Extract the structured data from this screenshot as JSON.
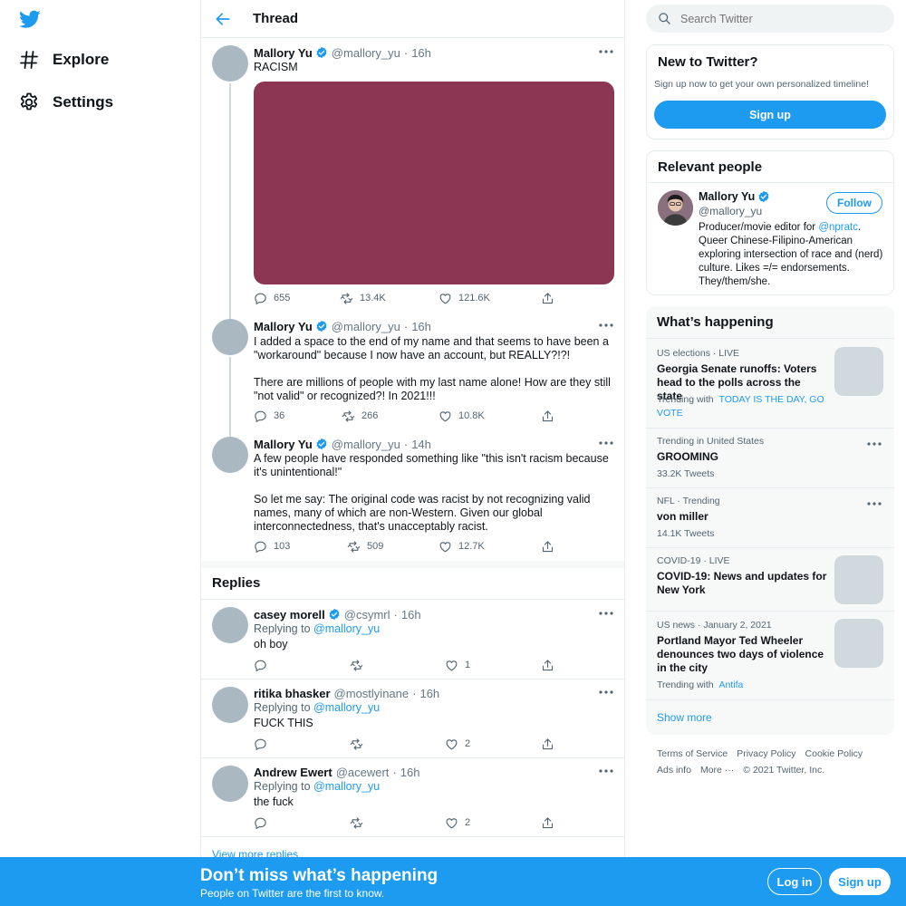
{
  "colors": {
    "accent": "#1d9bf0",
    "media": "#8b3753",
    "bottom_bar": "#1d9bf0"
  },
  "nav": {
    "logo_icon": "twitter-bird-icon",
    "items": [
      {
        "label": "Explore",
        "icon": "hashtag-icon"
      },
      {
        "label": "Settings",
        "icon": "gear-icon"
      }
    ]
  },
  "header": {
    "title": "Thread",
    "back_icon": "arrow-left-icon"
  },
  "thread": [
    {
      "name": "Mallory Yu",
      "handle": "@mallory_yu",
      "time": "16h",
      "text": "RACISM",
      "replies": "655",
      "retweets": "13.4K",
      "likes": "121.6K"
    },
    {
      "name": "Mallory Yu",
      "handle": "@mallory_yu",
      "time": "16h",
      "text": "I added a space to the end of my name and that seems to have been a \"workaround\" because I now have an account, but REALLY?!?!\n\nThere are millions of people with my last name alone! How are they still \"not valid\" or recognized?! In 2021!!!",
      "replies": "36",
      "retweets": "266",
      "likes": "10.8K"
    },
    {
      "name": "Mallory Yu",
      "handle": "@mallory_yu",
      "time": "14h",
      "text": "A few people have responded something like \"this isn't racism because it's unintentional!\"\n\nSo let me say: The original code was racist by not recognizing valid names, many of which are non-Western. Given our global interconnectedness, that's unacceptably racist.",
      "replies": "103",
      "retweets": "509",
      "likes": "12.7K"
    }
  ],
  "replies_section": {
    "title": "Replies",
    "replying_prefix": "Replying to",
    "items": [
      {
        "name": "casey morell",
        "verified": true,
        "handle": "@csymrl",
        "time": "16h",
        "replying_to": "@mallory_yu",
        "text": "oh boy",
        "likes": "1"
      },
      {
        "name": "ritika bhasker",
        "verified": false,
        "handle": "@mostlyinane",
        "time": "16h",
        "replying_to": "@mallory_yu",
        "text": "FUCK THIS",
        "likes": "2"
      },
      {
        "name": "Andrew Ewert",
        "verified": false,
        "handle": "@acewert",
        "time": "16h",
        "replying_to": "@mallory_yu",
        "text": "the fuck",
        "likes": "2"
      }
    ],
    "view_more": "View more replies"
  },
  "search": {
    "placeholder": "Search Twitter"
  },
  "new_to_twitter": {
    "title": "New to Twitter?",
    "subtitle": "Sign up now to get your own personalized timeline!",
    "button": "Sign up"
  },
  "relevant_people": {
    "title": "Relevant people",
    "name": "Mallory Yu",
    "handle": "@mallory_yu",
    "follow": "Follow",
    "bio_prefix": "Producer/movie editor for ",
    "bio_link": "@npratc",
    "bio_rest": ". Queer Chinese-Filipino-American exploring intersection of race and (nerd) culture. Likes =/= endorsements. They/them/she."
  },
  "whats_happening": {
    "title": "What’s happening",
    "trends": [
      {
        "meta": "US elections · LIVE",
        "title": "Georgia Senate runoffs: Voters head to the polls across the state",
        "sub_prefix": "Trending with",
        "sub_link": "TODAY IS THE DAY, GO VOTE",
        "has_thumb": true
      },
      {
        "meta": "Trending in United States",
        "title": "GROOMING",
        "count": "33.2K Tweets",
        "has_thumb": false
      },
      {
        "meta": "NFL · Trending",
        "title": "von miller",
        "count": "14.1K Tweets",
        "has_thumb": false
      },
      {
        "meta": "COVID-19 · LIVE",
        "title": "COVID-19: News and updates for New York",
        "has_thumb": true
      },
      {
        "meta": "US news · January 2, 2021",
        "title": "Portland Mayor Ted Wheeler denounces two days of violence in the city",
        "sub_prefix": "Trending with",
        "sub_link": "Antifa",
        "has_thumb": true
      }
    ],
    "show_more": "Show more"
  },
  "footer": {
    "links": [
      "Terms of Service",
      "Privacy Policy",
      "Cookie Policy",
      "Ads info",
      "More ···"
    ],
    "copyright": "© 2021 Twitter, Inc."
  },
  "bottom_bar": {
    "title": "Don’t miss what’s happening",
    "subtitle": "People on Twitter are the first to know.",
    "login": "Log in",
    "signup": "Sign up"
  }
}
